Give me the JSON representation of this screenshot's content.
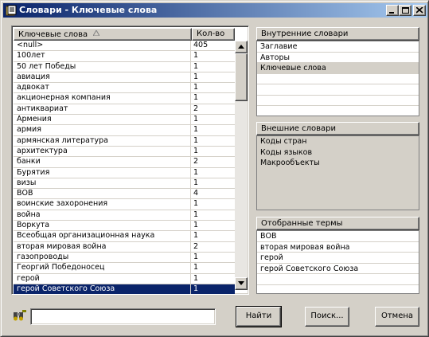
{
  "window": {
    "title": "Словари - Ключевые слова",
    "icon": "dictionary-icon"
  },
  "controls": {
    "minimize_icon": "minimize-icon",
    "maximize_icon": "maximize-icon",
    "close_icon": "close-icon"
  },
  "keywords_table": {
    "columns": [
      "Ключевые слова",
      "Кол-во"
    ],
    "sort_icon": "sort-ascending-icon",
    "rows": [
      [
        "<null>",
        "405"
      ],
      [
        "100лет",
        "1"
      ],
      [
        "50 лет Победы",
        "1"
      ],
      [
        "авиация",
        "1"
      ],
      [
        "адвокат",
        "1"
      ],
      [
        "акционерная компания",
        "1"
      ],
      [
        "антиквариат",
        "2"
      ],
      [
        "Армения",
        "1"
      ],
      [
        "армия",
        "1"
      ],
      [
        "армянская литература",
        "1"
      ],
      [
        "архитектура",
        "1"
      ],
      [
        "банки",
        "2"
      ],
      [
        "Бурятия",
        "1"
      ],
      [
        "визы",
        "1"
      ],
      [
        "ВОВ",
        "4"
      ],
      [
        "воинские захоронения",
        "1"
      ],
      [
        "война",
        "1"
      ],
      [
        "Воркута",
        "1"
      ],
      [
        "Всеобщая организационная наука",
        "1"
      ],
      [
        "вторая мировая война",
        "2"
      ],
      [
        "газопроводы",
        "1"
      ],
      [
        "Георгий Победоносец",
        "1"
      ],
      [
        "герой",
        "1"
      ],
      [
        "герой Советского Союза",
        "1"
      ]
    ],
    "selected_index": 23
  },
  "internal_dicts": {
    "header": "Внутренние словари",
    "items": [
      "Заглавие",
      "Авторы",
      "Ключевые слова"
    ],
    "selected_index": 2
  },
  "external_dicts": {
    "header": "Внешние словари",
    "items": [
      "Коды стран",
      "Коды языков",
      "Макрообъекты"
    ]
  },
  "selected_terms": {
    "header": "Отобранные термы",
    "items": [
      "ВОВ",
      "вторая мировая война",
      "герой",
      "герой Советского Союза"
    ]
  },
  "search": {
    "icon": "find-binoculars-icon",
    "value": "",
    "find_label": "Найти",
    "search_label": "Поиск...",
    "cancel_label": "Отмена"
  }
}
